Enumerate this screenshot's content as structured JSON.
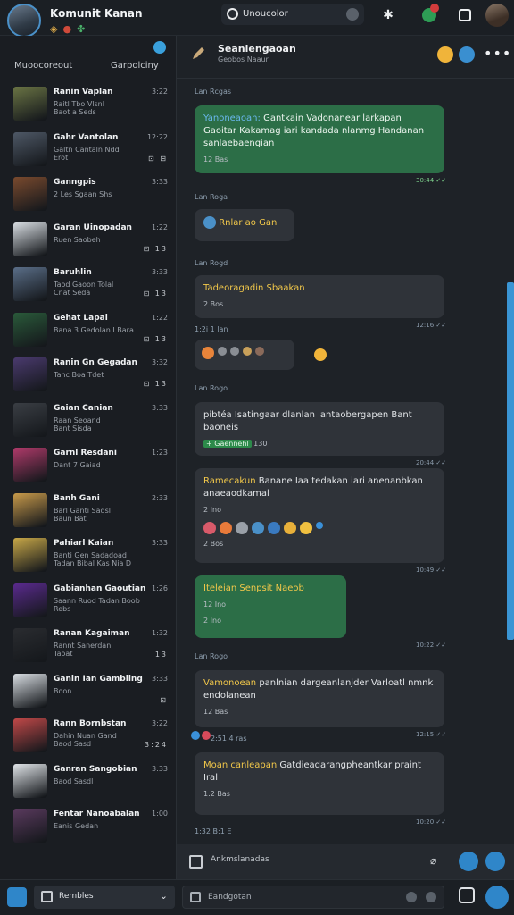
{
  "app": {
    "title": "Komunit Kanan",
    "status_icons": [
      "shield-icon",
      "record-icon",
      "clover-icon"
    ],
    "search_label": "Unoucolor"
  },
  "sidebar": {
    "tabs": [
      "Muoocoreout",
      "Garpolciny"
    ],
    "chats": [
      {
        "name": "Ranin Vaplan",
        "preview": "Raitl Tbo Vlsnl",
        "preview2": "Baot a Seds",
        "time": "3:22",
        "actions": "",
        "thumb": "#6a7444"
      },
      {
        "name": "Gahr Vantolan",
        "preview": "Galtn Cantaln Ndd",
        "preview2": "Erot",
        "time": "12:22",
        "actions": "⊡ ⊟",
        "thumb": "#4e5866"
      },
      {
        "name": "Ganngpis",
        "preview": "2 Les Sgaan Shs",
        "preview2": "",
        "time": "3:33",
        "actions": "",
        "thumb": "#7a4a2e"
      },
      {
        "name": "Garan Uinopadan",
        "preview": "Ruen Saobeh",
        "preview2": "",
        "time": "1:22",
        "actions": "⊡ 13",
        "thumb": "#d8dde2"
      },
      {
        "name": "Baruhlin",
        "preview": "Taod Gaoon Tolal",
        "preview2": "Cnat Seda",
        "time": "3:33",
        "actions": "⊡ 13",
        "thumb": "#5a6e88"
      },
      {
        "name": "Gehat Lapal",
        "preview": "Bana 3 Gedolan I Bara",
        "preview2": "",
        "time": "1:22",
        "actions": "⊡ 13",
        "thumb": "#2a5a3a"
      },
      {
        "name": "Ranin Gn Gegadan",
        "preview": "Tanc Boa Tdet",
        "preview2": "",
        "time": "3:32",
        "actions": "⊡ 13",
        "thumb": "#4a3a6e"
      },
      {
        "name": "Gaian Canian",
        "preview": "Raan Seoand",
        "preview2": "Bant Sisda",
        "time": "3:33",
        "actions": "",
        "thumb": "#3a3e44"
      },
      {
        "name": "Garnl Resdani",
        "preview": "Dant 7 Gaiad",
        "preview2": "",
        "time": "1:23",
        "actions": "",
        "thumb": "#b03a6a"
      },
      {
        "name": "Banh Gani",
        "preview": "Barl Ganti Sadsl",
        "preview2": "Baun Bat",
        "time": "2:33",
        "actions": "",
        "thumb": "#c89a4a"
      },
      {
        "name": "Pahiarl Kaian",
        "preview": "Banti Gen Sadadoad",
        "preview2": "Tadan Bibal Kas Nia D",
        "time": "3:33",
        "actions": "",
        "thumb": "#c8a848"
      },
      {
        "name": "Gabianhan Gaoutian",
        "preview": "Saann Ruod Tadan Boob",
        "preview2": "Rebs",
        "time": "1:26",
        "actions": "",
        "thumb": "#5a2a8e"
      },
      {
        "name": "Ranan Kagaiman",
        "preview": "Rannt Sanerdan",
        "preview2": "Taoat",
        "time": "1:32",
        "actions": "13",
        "thumb": "#2a2c30"
      },
      {
        "name": "Ganin Ian Gambling",
        "preview": "Boon",
        "preview2": "",
        "time": "3:33",
        "actions": "⊡",
        "thumb": "#d8dde2"
      },
      {
        "name": "Rann Bornbstan",
        "preview": "Dahin Nuan Gand",
        "preview2": "Baod Sasd",
        "time": "3:22",
        "actions": "3:24",
        "thumb": "#c04848"
      },
      {
        "name": "Ganran Sangobian",
        "preview": "Baod Sasdl",
        "preview2": "",
        "time": "3:33",
        "actions": "",
        "thumb": "#e0e4e8"
      },
      {
        "name": "Fentar Nanoabalan",
        "preview": "Eanis Gedan",
        "preview2": "",
        "time": "1:00",
        "actions": "",
        "thumb": "#5a3a5e"
      }
    ]
  },
  "chat": {
    "title": "Seaniengaoan",
    "subtitle": "Geobos Naaur",
    "messages": [
      {
        "kind": "date",
        "text": "Lan Rcgas"
      },
      {
        "kind": "green",
        "lead": "Yanoneaoan:",
        "text": "Gantkain Vadonanear larkapan Gaoitar Kakamag iari kandada nlanmg Handanan sanlaebaengian",
        "meta": "12 Bas",
        "stamp": "30:44 ✓✓"
      },
      {
        "kind": "date",
        "text": "Lan Roga"
      },
      {
        "kind": "gray",
        "text": "Rnlar ao Gan"
      },
      {
        "kind": "date",
        "text": "Lan Rogd"
      },
      {
        "kind": "gray",
        "text": "Tadeoragadin Sbaakan",
        "meta": "2 Bos",
        "stamp": "12:16 ✓✓"
      },
      {
        "kind": "date",
        "text": "1:2i 1 lan"
      },
      {
        "kind": "date",
        "text": "Lan Rogo"
      },
      {
        "kind": "gray",
        "text": "pibtéa Isatingaar dlanlan lantaobergapen Bant baoneis",
        "tag": "+ Gaennehl",
        "meta": "130",
        "stamp": "20:44 ✓✓"
      },
      {
        "kind": "gray",
        "lead": "Ramecakun",
        "text": "Banane Iaa tedakan iari anenanbkan anaeaodkamal",
        "meta": "2 Ino",
        "meta2": "2 Bos",
        "stamp": "10:49 ✓✓"
      },
      {
        "kind": "green",
        "text": "Iteleian Senpsit Naeob",
        "meta": "12 Ino",
        "meta2": "2 Ino",
        "stamp": "10:22 ✓✓"
      },
      {
        "kind": "date",
        "text": "Lan Rogo"
      },
      {
        "kind": "gray",
        "lead": "Vamonoean",
        "text": "panlnian dargeanlanjder Varloatl nmnk endolanean",
        "meta": "12 Bas",
        "stamp": "12:15 ✓✓"
      },
      {
        "kind": "date",
        "text": "2:51 4 ras"
      },
      {
        "kind": "gray",
        "lead": "Moan canleapan",
        "text": "Gatdieadarangpheantkar praint Iral",
        "meta": "1:2 Bas",
        "stamp": "10:20 ✓✓"
      },
      {
        "kind": "date",
        "text": "1:32 B:1 E"
      }
    ],
    "composer_placeholder": "Ankmslanadas"
  },
  "bottombar": {
    "select_label": "Rembles",
    "search_placeholder": "Eandgotan"
  },
  "colors": {
    "accent": "#2f86c9",
    "bubble_green": "#2c6e47",
    "bubble_gray": "#2f3339",
    "background": "#16191e"
  }
}
